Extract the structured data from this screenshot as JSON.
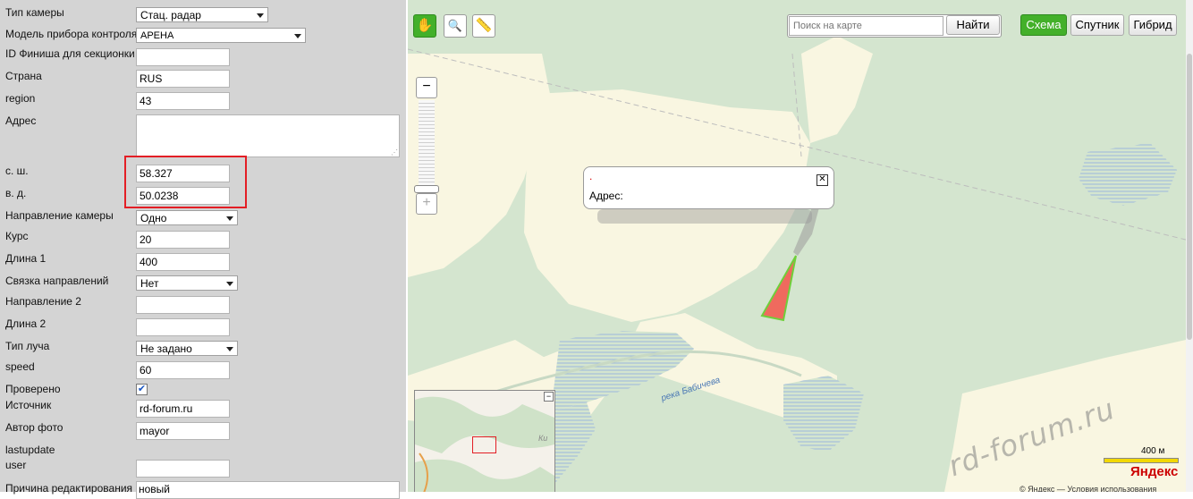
{
  "form": {
    "camera_type": {
      "label": "Тип камеры",
      "value": "Стац. радар"
    },
    "device_model": {
      "label": "Модель прибора контроля",
      "value": "АРЕНА"
    },
    "finish_id": {
      "label": "ID Финиша для секционки",
      "value": ""
    },
    "country": {
      "label": "Страна",
      "value": "RUS"
    },
    "region": {
      "label": "region",
      "value": "43"
    },
    "address": {
      "label": "Адрес",
      "value": ""
    },
    "latitude": {
      "label": "с. ш.",
      "value": "58.327"
    },
    "longitude": {
      "label": "в. д.",
      "value": "50.0238"
    },
    "camera_direction": {
      "label": "Направление камеры",
      "value": "Одно"
    },
    "course": {
      "label": "Курс",
      "value": "20"
    },
    "length1": {
      "label": "Длина 1",
      "value": "400"
    },
    "direction_link": {
      "label": "Связка направлений",
      "value": "Нет"
    },
    "direction2": {
      "label": "Направление 2",
      "value": ""
    },
    "length2": {
      "label": "Длина 2",
      "value": ""
    },
    "beam_type": {
      "label": "Тип луча",
      "value": "Не задано"
    },
    "speed": {
      "label": "speed",
      "value": "60"
    },
    "verified": {
      "label": "Проверено",
      "checked": true
    },
    "source": {
      "label": "Источник",
      "value": "rd-forum.ru"
    },
    "photo_author": {
      "label": "Автор фото",
      "value": "mayor"
    },
    "lastupdate": {
      "label": "lastupdate"
    },
    "user": {
      "label": "user",
      "value": ""
    },
    "edit_reason": {
      "label": "Причина редактирования",
      "value": "новый"
    }
  },
  "map": {
    "search_placeholder": "Поиск на карте",
    "search_button": "Найти",
    "layers": [
      "Схема",
      "Спутник",
      "Гибрид"
    ],
    "active_layer": "Схема",
    "balloon_address_label": "Адрес:",
    "river_label": "река Бабичева",
    "minimap_label": "Ки",
    "scale_label": "400 м",
    "logo": "Яндекс",
    "copyright": "© Яндекс — Условия использования",
    "watermark": "rd-forum.ru",
    "tools": [
      "hand-tool",
      "magnifier-tool",
      "ruler-tool"
    ]
  },
  "colors": {
    "highlight": "#e31e25",
    "active_layer_bg": "#43b02a",
    "forest": "#d4e5cf",
    "field": "#f9f6e1",
    "camera_sector_fill": "#ef6a5e",
    "camera_sector_stroke": "#6fcf3a"
  }
}
